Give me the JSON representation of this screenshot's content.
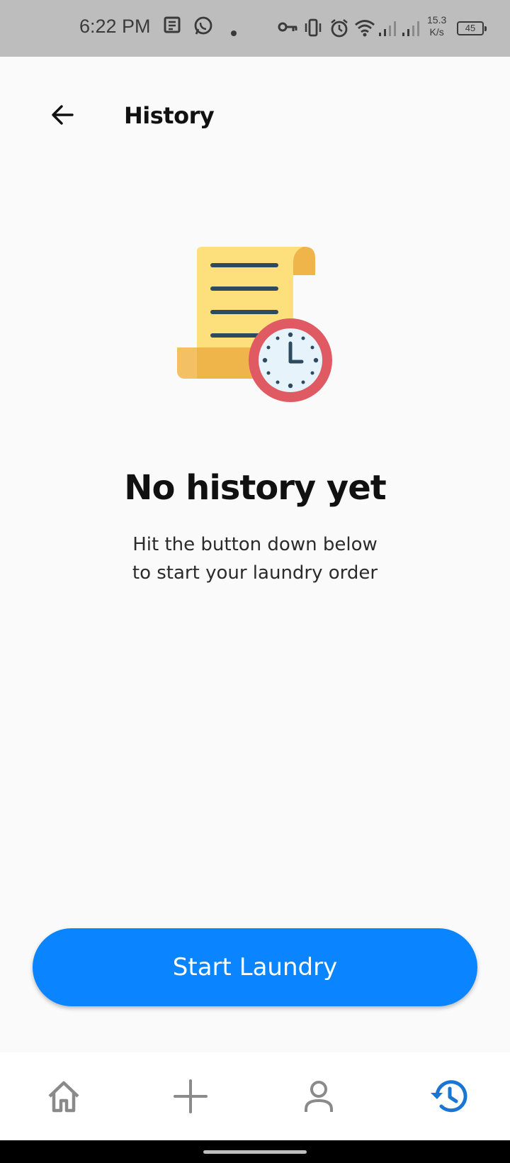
{
  "status_bar": {
    "time": "6:22 PM",
    "net_speed_value": "15.3",
    "net_speed_unit": "K/s",
    "battery": "45"
  },
  "header": {
    "title": "History",
    "back_icon": "arrow-left-icon"
  },
  "empty_state": {
    "illustration": "receipt-clock-illustration",
    "title": "No history yet",
    "subtitle_line1": "Hit the button down below",
    "subtitle_line2": "to start your laundry order"
  },
  "primary_action": {
    "label": "Start Laundry",
    "color": "#0a84ff"
  },
  "bottom_nav": {
    "items": [
      {
        "icon": "home-icon",
        "active": false
      },
      {
        "icon": "plus-icon",
        "active": false
      },
      {
        "icon": "user-icon",
        "active": false
      },
      {
        "icon": "history-icon",
        "active": true
      }
    ],
    "active_color": "#1976d2",
    "inactive_color": "#8a8a8a"
  }
}
